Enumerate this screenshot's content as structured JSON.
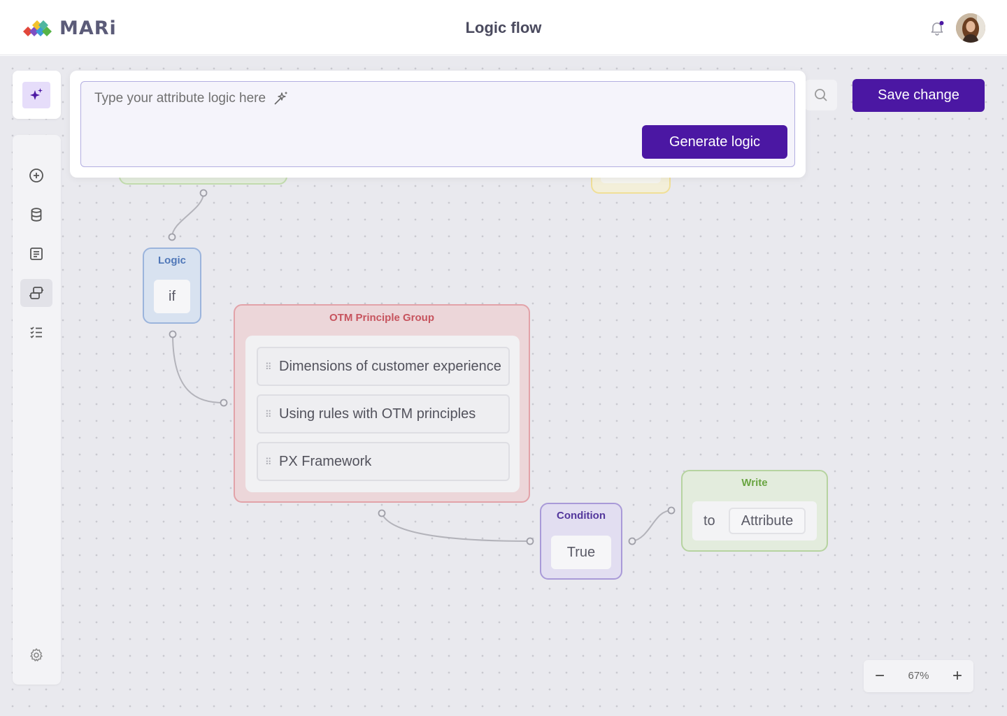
{
  "header": {
    "brand": "MARi",
    "title": "Logic flow"
  },
  "toolbar": {
    "save_label": "Save change"
  },
  "prompt": {
    "placeholder": "Type your attribute logic here",
    "generate_label": "Generate logic"
  },
  "sidebar": {
    "items": [
      {
        "icon": "add-circle-icon"
      },
      {
        "icon": "database-icon"
      },
      {
        "icon": "document-icon"
      },
      {
        "icon": "flow-icon",
        "active": true
      },
      {
        "icon": "checklist-icon"
      }
    ],
    "settings_icon": "gear-icon"
  },
  "nodes": {
    "logic": {
      "title": "Logic",
      "value": "if"
    },
    "group": {
      "title": "OTM Principle Group",
      "items": [
        "Dimensions of customer experience",
        "Using rules with OTM principles",
        "PX Framework"
      ]
    },
    "condition": {
      "title": "Condition",
      "value": "True"
    },
    "write": {
      "title": "Write",
      "to": "to",
      "target": "Attribute"
    }
  },
  "zoom": {
    "level": "67%",
    "minus": "−",
    "plus": "+"
  },
  "colors": {
    "primary": "#4b17a3",
    "logic": "#4f77b8",
    "group": "#c7545e",
    "condition": "#53379c",
    "write": "#6aa542"
  }
}
